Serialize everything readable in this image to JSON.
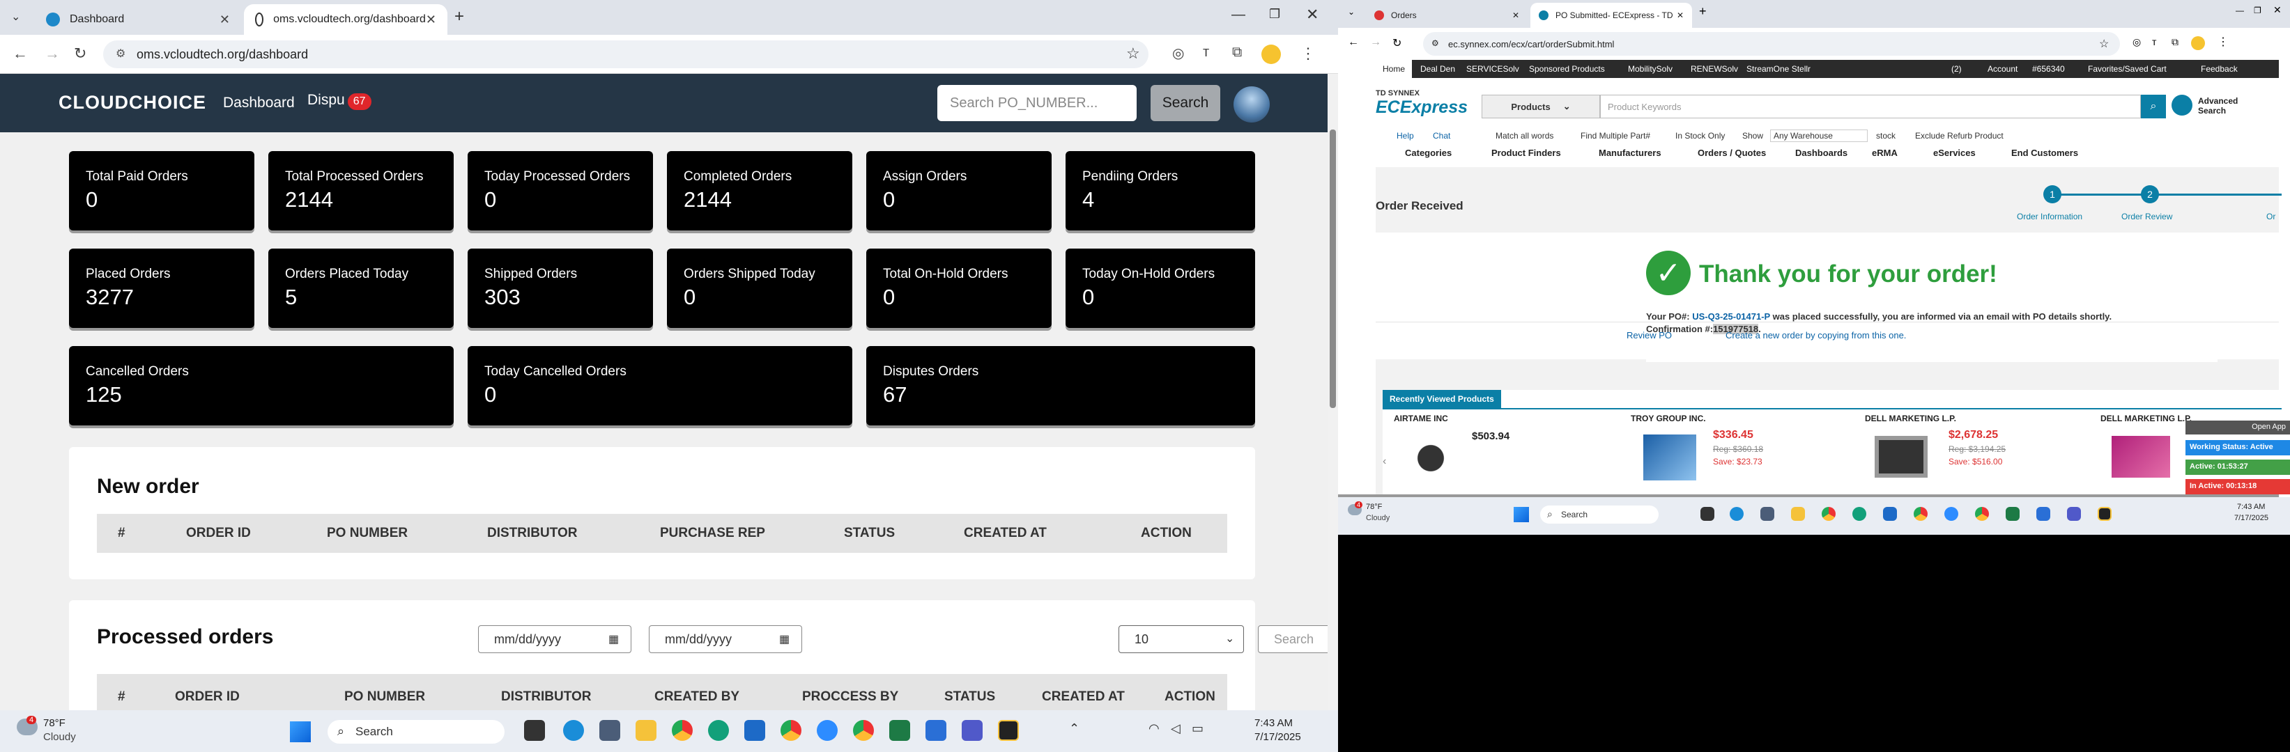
{
  "left": {
    "tabs": [
      {
        "label": "Dashboard"
      },
      {
        "label": "oms.vcloudtech.org/dashboard"
      }
    ],
    "url": "oms.vcloudtech.org/dashboard",
    "app": {
      "logo": "CLOUDCHOICE",
      "nav_dashboard": "Dashboard",
      "nav_disputes": "Dispu",
      "disputes_badge": "67",
      "search_placeholder": "Search PO_NUMBER...",
      "search_button": "Search"
    },
    "cards": [
      {
        "label": "Total Paid Orders",
        "value": "0"
      },
      {
        "label": "Total Processed Orders",
        "value": "2144"
      },
      {
        "label": "Today Processed Orders",
        "value": "0"
      },
      {
        "label": "Completed Orders",
        "value": "2144"
      },
      {
        "label": "Assign Orders",
        "value": "0"
      },
      {
        "label": "Pendiing Orders",
        "value": "4"
      },
      {
        "label": "Placed Orders",
        "value": "3277"
      },
      {
        "label": "Orders Placed Today",
        "value": "5"
      },
      {
        "label": "Shipped Orders",
        "value": "303"
      },
      {
        "label": "Orders Shipped Today",
        "value": "0"
      },
      {
        "label": "Total On-Hold Orders",
        "value": "0"
      },
      {
        "label": "Today On-Hold Orders",
        "value": "0"
      },
      {
        "label": "Cancelled Orders",
        "value": "125"
      },
      {
        "label": "Today Cancelled Orders",
        "value": "0"
      },
      {
        "label": "Disputes Orders",
        "value": "67"
      }
    ],
    "new_order": {
      "title": "New order",
      "columns": [
        "#",
        "ORDER ID",
        "PO NUMBER",
        "DISTRIBUTOR",
        "PURCHASE REP",
        "STATUS",
        "CREATED AT",
        "ACTION"
      ]
    },
    "processed": {
      "title": "Processed orders",
      "date_from": "mm/dd/yyyy",
      "date_to": "mm/dd/yyyy",
      "page_size": "10",
      "search_placeholder": "Search",
      "columns": [
        "#",
        "ORDER ID",
        "PO NUMBER",
        "DISTRIBUTOR",
        "CREATED BY",
        "PROCCESS BY",
        "STATUS",
        "CREATED AT",
        "ACTION"
      ]
    },
    "taskbar": {
      "weather_temp": "78°F",
      "weather_desc": "Cloudy",
      "weather_badge": "4",
      "search": "Search",
      "time": "7:43 AM",
      "date": "7/17/2025"
    }
  },
  "right": {
    "tabs": [
      {
        "label": "Orders"
      },
      {
        "label": "PO Submitted- ECExpress - TD"
      }
    ],
    "url": "ec.synnex.com/ecx/cart/orderSubmit.html",
    "topnav": [
      "Home",
      "Deal Den",
      "SERVICESolv",
      "Sponsored Products",
      "MobilitySolv",
      "RENEWSolv",
      "StreamOne Stellr"
    ],
    "topnav_right": {
      "cart_count": "(2)",
      "account": "Account",
      "acct_no": "#656340",
      "favorites": "Favorites/Saved Cart",
      "feedback": "Feedback"
    },
    "brand_top": "TD SYNNEX",
    "brand": "ECExpress",
    "product_select": "Products",
    "keyword_placeholder": "Product Keywords",
    "advanced_search": "Advanced Search",
    "sub": {
      "help": "Help",
      "chat": "Chat",
      "match_all": "Match all words",
      "find_multiple": "Find Multiple Part#",
      "in_stock": "In Stock Only",
      "show": "Show",
      "warehouse": "Any Warehouse",
      "stock": "stock",
      "exclude": "Exclude Refurb Product"
    },
    "menu": [
      "Categories",
      "Product Finders",
      "Manufacturers",
      "Orders / Quotes",
      "Dashboards",
      "eRMA",
      "eServices",
      "End Customers"
    ],
    "order_received": "Order Received",
    "steps": [
      {
        "num": "1",
        "label": "Order Information"
      },
      {
        "num": "2",
        "label": "Order Review"
      },
      {
        "label": "Or"
      }
    ],
    "thank_you": "Thank you for your order!",
    "msg_prefix": "Your PO#: ",
    "po_number": "US-Q3-25-01471-P",
    "msg_mid": " was placed successfully, you are informed via an email with PO details shortly. Confirmation #:",
    "confirmation": "151977518",
    "msg_end": ".",
    "review_po": "Review PO",
    "create_new": "Create a new order by copying from this one.",
    "recently_viewed": "Recently Viewed Products",
    "products": [
      {
        "vendor": "AIRTAME INC",
        "price": "$503.94"
      },
      {
        "vendor": "TROY GROUP INC.",
        "price": "$336.45",
        "reg": "Reg: $360.18",
        "save": "Save: $23.73"
      },
      {
        "vendor": "DELL MARKETING L.P.",
        "price": "$2,678.25",
        "reg": "Reg: $3,194.25",
        "save": "Save: $516.00"
      },
      {
        "vendor": "DELL MARKETING L.P."
      }
    ],
    "side_widget": {
      "open_app": "Open App",
      "working": "Working Status: Active",
      "active": "Active: 01:53:27",
      "inactive": "In Active: 00:13:18"
    },
    "taskbar": {
      "weather_temp": "78°F",
      "weather_desc": "Cloudy",
      "weather_badge": "4",
      "search": "Search",
      "time": "7:43 AM",
      "date": "7/17/2025"
    }
  }
}
